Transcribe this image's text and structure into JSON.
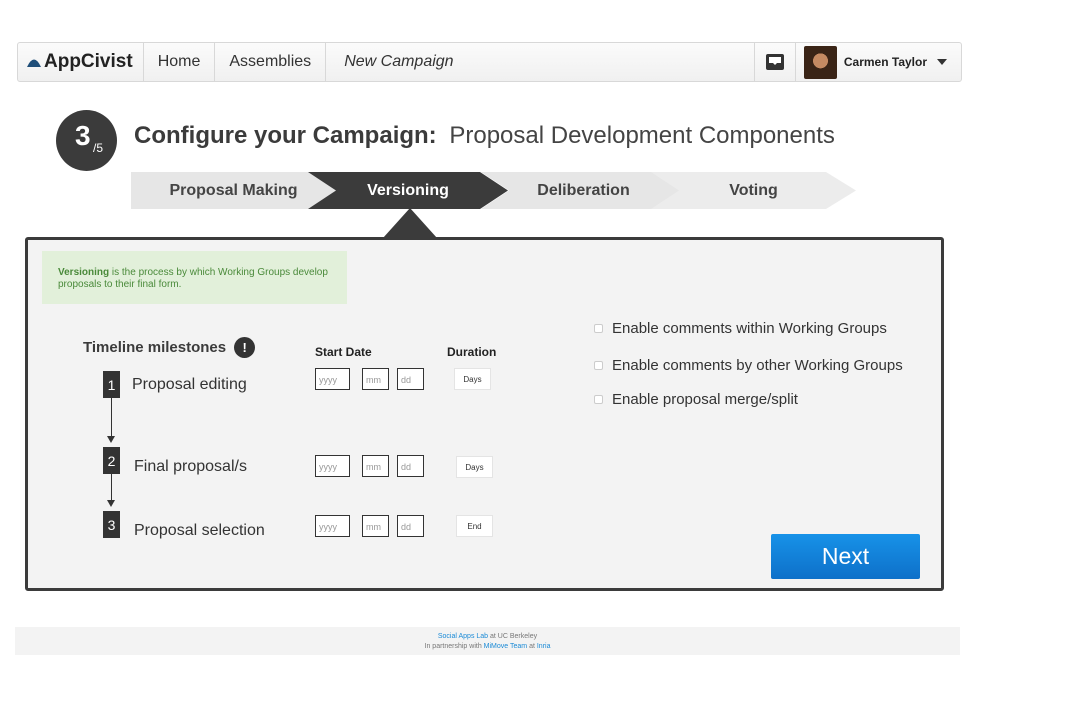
{
  "navbar": {
    "brand": "AppCivist",
    "home": "Home",
    "assemblies": "Assemblies",
    "current": "New Campaign",
    "user_name": "Carmen Taylor"
  },
  "step": {
    "number": "3",
    "of": "/5",
    "title_bold": "Configure your Campaign:",
    "title_rest": "Proposal Development Components"
  },
  "wizard": {
    "steps": [
      "Proposal Making",
      "Versioning",
      "Deliberation",
      "Voting"
    ],
    "active": "Versioning"
  },
  "info": {
    "term": "Versioning",
    "text": " is the process by which Working Groups develop proposals to their final form."
  },
  "timeline": {
    "title": "Timeline milestones",
    "alert": "!",
    "start_date_label": "Start Date",
    "duration_label": "Duration",
    "milestones": [
      {
        "num": "1",
        "label": "Proposal editing",
        "duration": "Days"
      },
      {
        "num": "2",
        "label": "Final proposal/s",
        "duration": "Days"
      },
      {
        "num": "3",
        "label": "Proposal selection",
        "duration": "End"
      }
    ],
    "placeholders": {
      "year": "yyyy",
      "month": "mm",
      "day": "dd"
    }
  },
  "options": [
    "Enable comments within Working Groups",
    "Enable comments by other Working Groups",
    "Enable proposal merge/split"
  ],
  "next_label": "Next",
  "footer": {
    "lab": "Social Apps Lab",
    "lab_suffix": " at UC Berkeley",
    "partnership": "In partnership with ",
    "team": "MiMove Team",
    "at": " at ",
    "inria": "Inria"
  },
  "colors": {
    "dark": "#3b3b3b",
    "accent_blue": "#1582dd",
    "info_bg": "#e2f0da",
    "info_text": "#4a8a3a"
  }
}
